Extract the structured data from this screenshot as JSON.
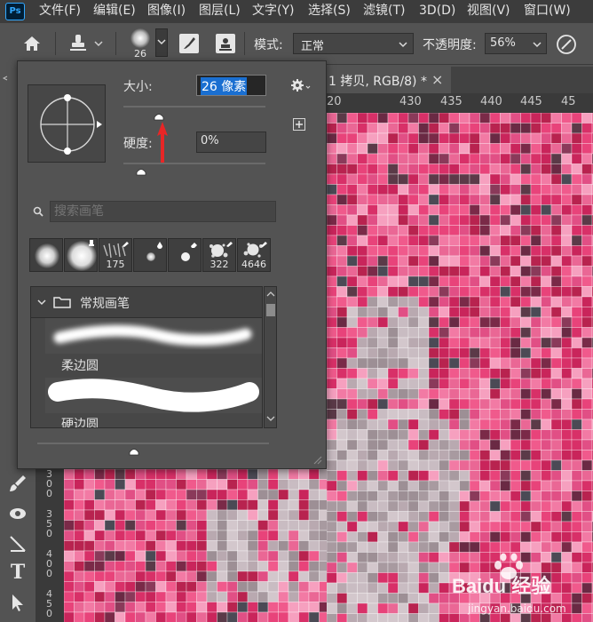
{
  "app": {
    "logo_text": "Ps"
  },
  "menu": {
    "items": [
      "文件(F)",
      "编辑(E)",
      "图像(I)",
      "图层(L)",
      "文字(Y)",
      "选择(S)",
      "滤镜(T)",
      "3D(D)",
      "视图(V)",
      "窗口(W)"
    ]
  },
  "options_bar": {
    "brush_size": "26",
    "mode_label": "模式:",
    "mode_value": "正常",
    "opacity_label": "不透明度:",
    "opacity_value": "56%"
  },
  "document": {
    "tab_title": "1 拷贝, RGB/8) *",
    "close_glyph": "×",
    "ruler_h": [
      "20",
      "430",
      "435",
      "440",
      "445",
      "45"
    ],
    "ruler_v_columns": [
      [
        "3",
        "0",
        "0"
      ],
      [
        "3",
        "5",
        "0"
      ],
      [
        "4",
        "0",
        "0"
      ],
      [
        "4",
        "5",
        "0"
      ]
    ]
  },
  "brush_panel": {
    "size_label": "大小:",
    "size_value": "26 像素",
    "size_fraction": 0.09,
    "hardness_label": "硬度:",
    "hardness_value": "0%",
    "hardness_fraction": 0.0,
    "search_placeholder": "搜索画笔",
    "presets": [
      {
        "type": "soft",
        "label": ""
      },
      {
        "type": "soft-large",
        "label": ""
      },
      {
        "type": "texture",
        "label": "175"
      },
      {
        "type": "small-soft",
        "label": ""
      },
      {
        "type": "small-hard",
        "label": ""
      },
      {
        "type": "splatter",
        "label": "322"
      },
      {
        "type": "splatter",
        "label": "4646"
      }
    ],
    "group_name": "常规画笔",
    "brushes": [
      {
        "name": "柔边圆"
      },
      {
        "name": "硬边圆"
      }
    ],
    "preview_scale_fraction": 0.34
  },
  "watermark": {
    "text": "Baidu 经验",
    "sub": "jingyan.baidu.com"
  },
  "colors": {
    "accent": "#31a8ff",
    "canvas_pink": "#e8437a",
    "annotation_arrow": "#e82626"
  }
}
